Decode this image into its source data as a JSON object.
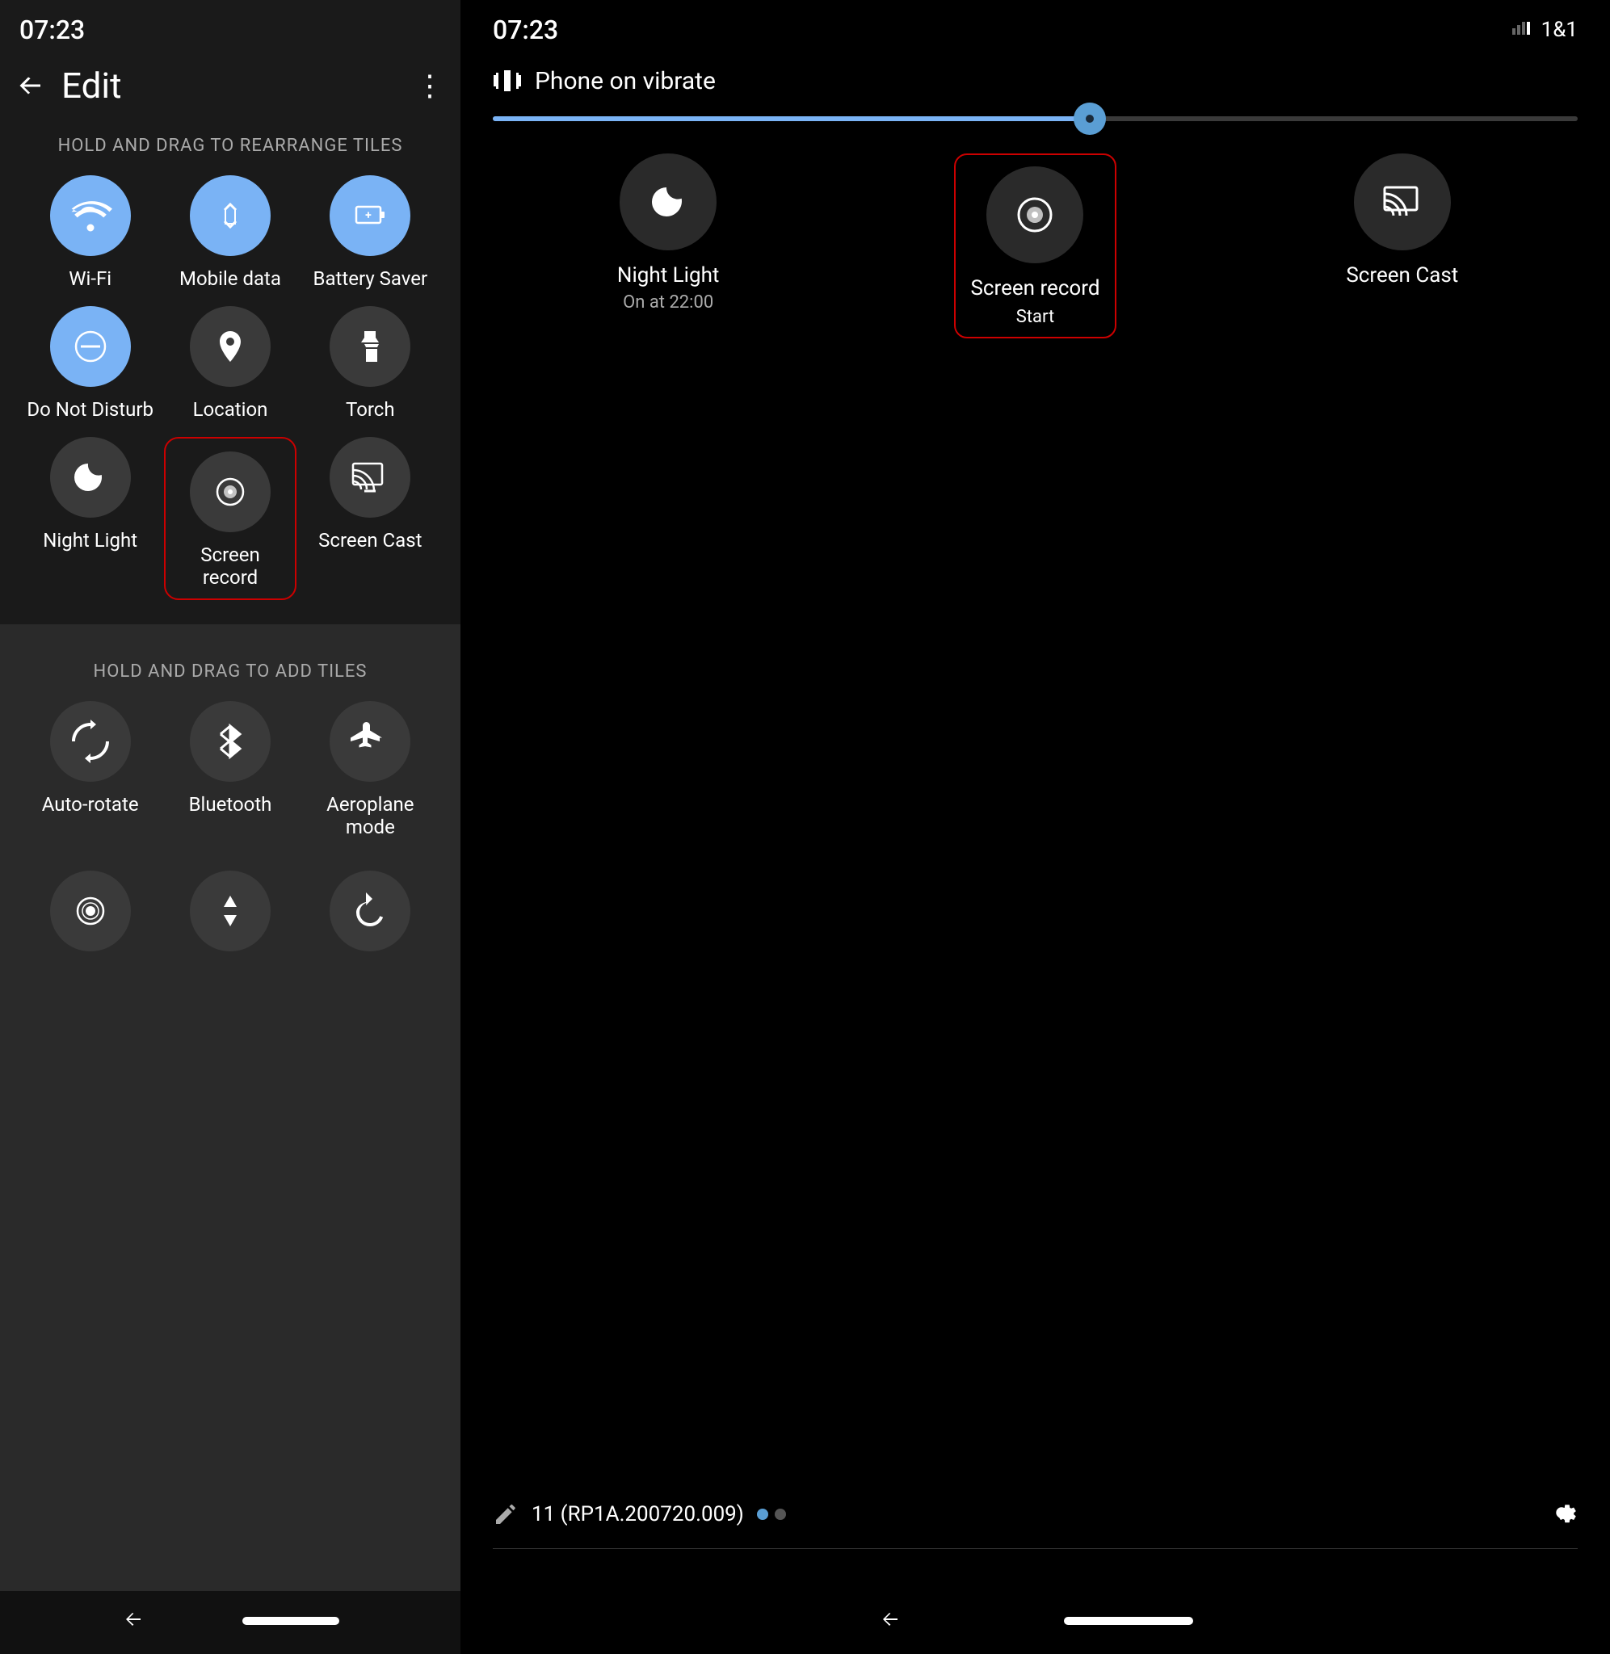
{
  "left": {
    "time": "07:23",
    "header": {
      "back_label": "←",
      "title": "Edit",
      "more_label": "⋮"
    },
    "section1_label": "HOLD AND DRAG TO REARRANGE TILES",
    "tiles": [
      {
        "id": "wifi",
        "label": "Wi-Fi",
        "active": true
      },
      {
        "id": "mobile-data",
        "label": "Mobile data",
        "active": true
      },
      {
        "id": "battery-saver",
        "label": "Battery Saver",
        "active": true
      },
      {
        "id": "do-not-disturb",
        "label": "Do Not Disturb",
        "active": true
      },
      {
        "id": "location",
        "label": "Location",
        "active": false
      },
      {
        "id": "torch",
        "label": "Torch",
        "active": false
      },
      {
        "id": "night-light",
        "label": "Night Light",
        "active": false
      },
      {
        "id": "screen-record",
        "label": "Screen record",
        "active": false,
        "highlighted": true
      },
      {
        "id": "screen-cast",
        "label": "Screen Cast",
        "active": false
      }
    ],
    "section2_label": "HOLD AND DRAG TO ADD TILES",
    "add_tiles": [
      {
        "id": "auto-rotate",
        "label": "Auto-rotate"
      },
      {
        "id": "bluetooth",
        "label": "Bluetooth"
      },
      {
        "id": "aeroplane-mode",
        "label": "Aeroplane mode"
      }
    ]
  },
  "right": {
    "time": "07:23",
    "vibrate_label": "Phone on vibrate",
    "carrier": "1&1",
    "brightness_percent": 55,
    "tiles": [
      {
        "id": "night-light",
        "label": "Night Light",
        "sublabel": "On at 22:00"
      },
      {
        "id": "screen-record",
        "label": "Screen record",
        "sublabel": "Start",
        "highlighted": true
      },
      {
        "id": "screen-cast",
        "label": "Screen Cast",
        "sublabel": ""
      }
    ],
    "build_info": "11 (RP1A.200720.009)",
    "settings_icon": "⚙"
  }
}
